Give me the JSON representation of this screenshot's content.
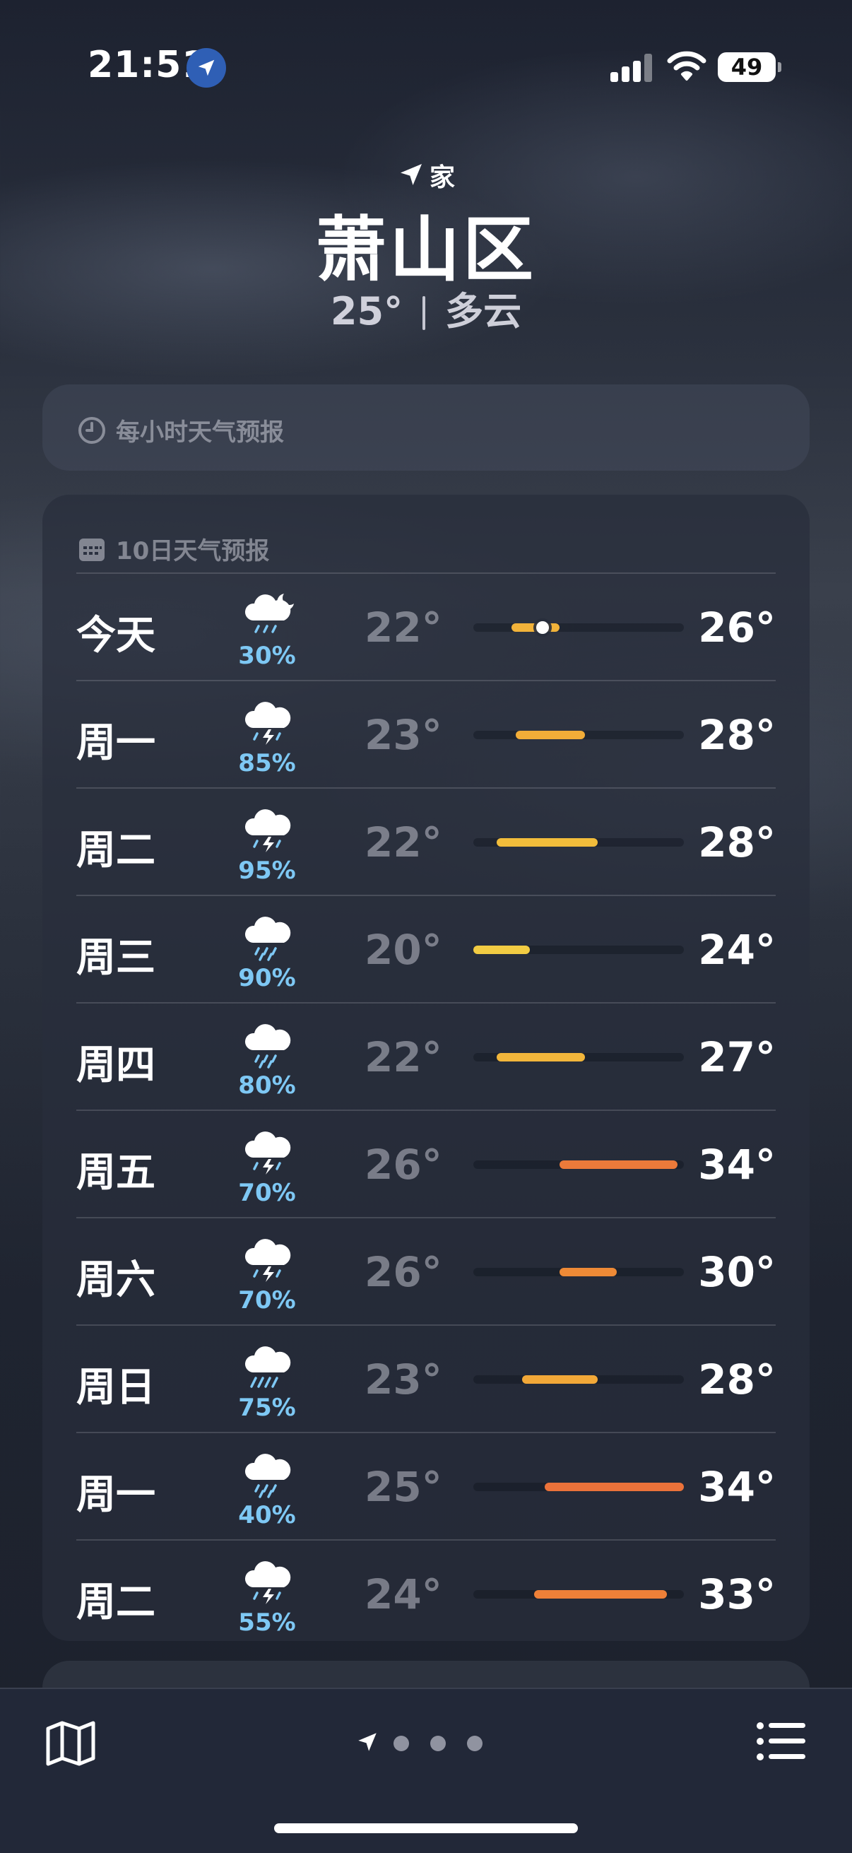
{
  "status_bar": {
    "time": "21:51",
    "battery": "49"
  },
  "header": {
    "location_label": "家",
    "city": "萧山区",
    "current_temp": "25°",
    "condition": "多云"
  },
  "hourly": {
    "title": "每小时天气预报"
  },
  "daily": {
    "title": "10日天气预报",
    "days": [
      {
        "name": "今天",
        "icon": "cloud-moon-rain-icon",
        "pop": "30%",
        "low": "22°",
        "high": "26°",
        "bar_start": 0.18,
        "bar_end": 0.41,
        "bar_color": "#f2b33a",
        "now_pos": 0.33
      },
      {
        "name": "周一",
        "icon": "cloud-bolt-rain-icon",
        "pop": "85%",
        "low": "23°",
        "high": "28°",
        "bar_start": 0.2,
        "bar_end": 0.53,
        "bar_color": "#f2ad38"
      },
      {
        "name": "周二",
        "icon": "cloud-bolt-rain-icon",
        "pop": "95%",
        "low": "22°",
        "high": "28°",
        "bar_start": 0.11,
        "bar_end": 0.59,
        "bar_color": "#f2bd3b"
      },
      {
        "name": "周三",
        "icon": "cloud-rain-icon",
        "pop": "90%",
        "low": "20°",
        "high": "24°",
        "bar_start": 0.0,
        "bar_end": 0.27,
        "bar_color": "#f2cc43"
      },
      {
        "name": "周四",
        "icon": "cloud-rain-icon",
        "pop": "80%",
        "low": "22°",
        "high": "27°",
        "bar_start": 0.11,
        "bar_end": 0.53,
        "bar_color": "#f2b63b"
      },
      {
        "name": "周五",
        "icon": "cloud-bolt-rain-icon",
        "pop": "70%",
        "low": "26°",
        "high": "34°",
        "bar_start": 0.41,
        "bar_end": 0.97,
        "bar_color": "#ec7a3a"
      },
      {
        "name": "周六",
        "icon": "cloud-bolt-rain-icon",
        "pop": "70%",
        "low": "26°",
        "high": "30°",
        "bar_start": 0.41,
        "bar_end": 0.68,
        "bar_color": "#ee8a36"
      },
      {
        "name": "周日",
        "icon": "cloud-heavy-rain-icon",
        "pop": "75%",
        "low": "23°",
        "high": "28°",
        "bar_start": 0.23,
        "bar_end": 0.59,
        "bar_color": "#f2a838"
      },
      {
        "name": "周一",
        "icon": "cloud-rain-icon",
        "pop": "40%",
        "low": "25°",
        "high": "34°",
        "bar_start": 0.34,
        "bar_end": 1.0,
        "bar_color": "#eb723a"
      },
      {
        "name": "周二",
        "icon": "cloud-bolt-rain-icon",
        "pop": "55%",
        "low": "24°",
        "high": "33°",
        "bar_start": 0.29,
        "bar_end": 0.92,
        "bar_color": "#ee8038"
      }
    ]
  },
  "bottom_bar": {
    "page_count": 4,
    "active_page": 0
  }
}
